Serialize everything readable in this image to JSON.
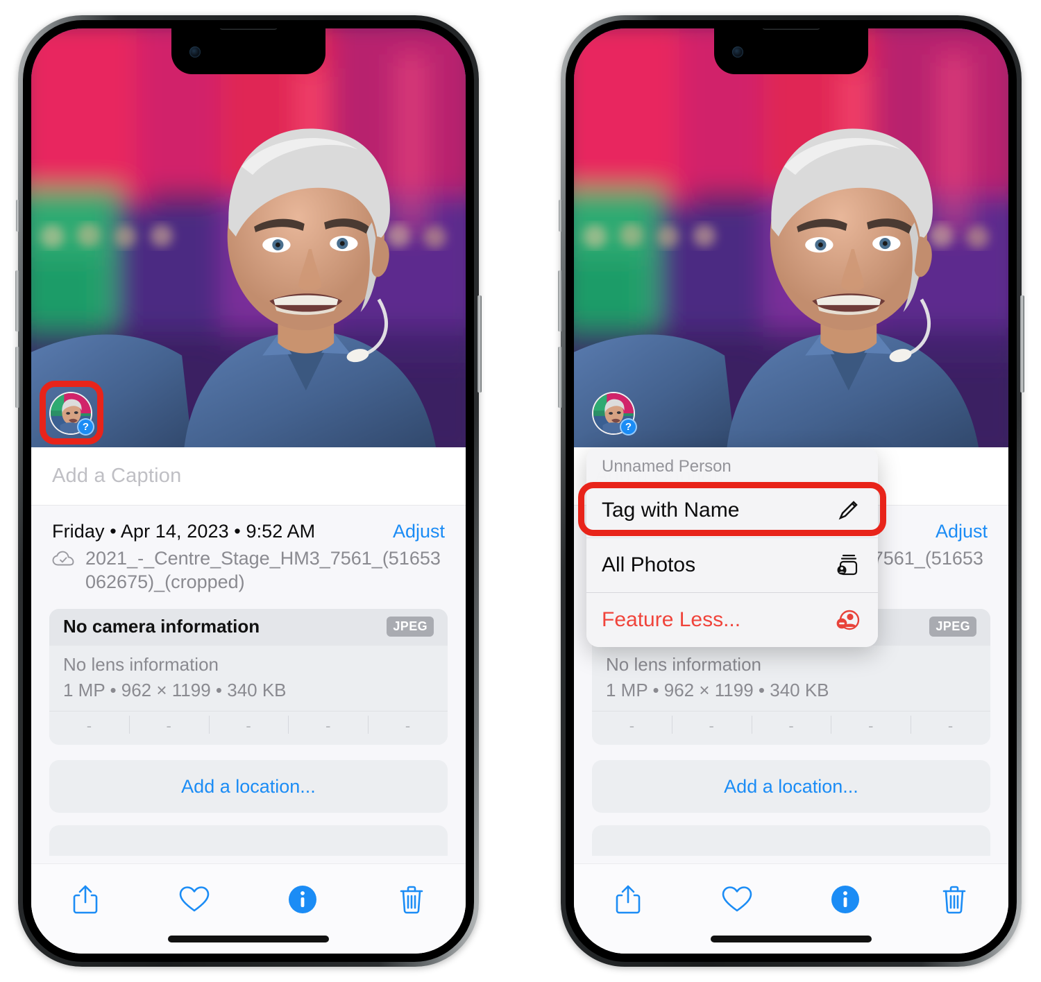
{
  "photo": {
    "alt_description": "Man with gray hair wearing a blue shirt on a stage with colorful blurred background",
    "face_badge": "?",
    "background_colors": [
      "#e8275e",
      "#c9256b",
      "#22a06b",
      "#7a3aa8",
      "#4a2a7a"
    ],
    "shirt_color": "#4a6c9e",
    "hair_color": "#dcdcdc"
  },
  "caption": {
    "placeholder": "Add a Caption",
    "value": ""
  },
  "meta": {
    "date_line": "Friday • Apr 14, 2023 • 9:52 AM",
    "adjust_label": "Adjust",
    "filename": "2021_-_Centre_Stage_HM3_7561_(51653062675)_(cropped)",
    "cloud_icon": "cloud-check-icon"
  },
  "detail_card": {
    "title": "No camera information",
    "format_badge": "JPEG",
    "lens": "No lens information",
    "specs": "1 MP • 962 × 1199 • 340 KB",
    "exif_placeholders": [
      "-",
      "-",
      "-",
      "-",
      "-"
    ]
  },
  "location": {
    "add_label": "Add a location..."
  },
  "toolbar": {
    "items": [
      {
        "name": "share-icon",
        "label": "Share"
      },
      {
        "name": "heart-icon",
        "label": "Favorite"
      },
      {
        "name": "info-icon",
        "label": "Info",
        "active": true
      },
      {
        "name": "trash-icon",
        "label": "Delete"
      }
    ],
    "accent_color": "#1b8cf5"
  },
  "context_menu": {
    "header": "Unnamed Person",
    "items": [
      {
        "label": "Tag with Name",
        "icon": "pencil-icon",
        "highlighted": true,
        "destructive": false
      },
      {
        "label": "All Photos",
        "icon": "photo-stack-person-icon",
        "highlighted": false,
        "destructive": false
      },
      {
        "label": "Feature Less...",
        "icon": "person-minus-icon",
        "highlighted": false,
        "destructive": true
      }
    ]
  },
  "annotations": {
    "color": "#e8241a",
    "left_phone_target": "face-thumbnail",
    "right_phone_target": "tag-with-name-menu-item"
  }
}
